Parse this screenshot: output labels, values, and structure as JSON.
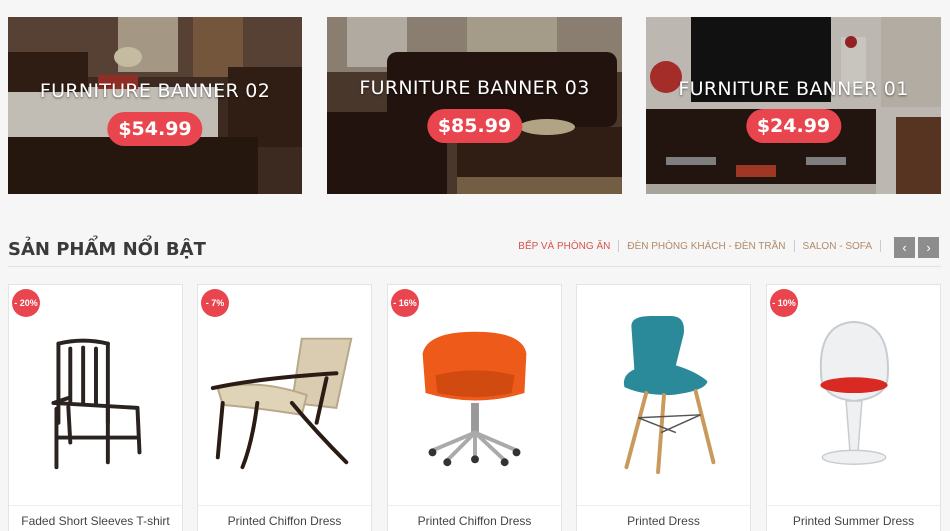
{
  "banners": [
    {
      "title": "FURNITURE BANNER 02",
      "price": "$54.99"
    },
    {
      "title": "FURNITURE BANNER 03",
      "price": "$85.99"
    },
    {
      "title": "FURNITURE BANNER 01",
      "price": "$24.99"
    }
  ],
  "section": {
    "title": "SẢN PHẨM NỔI BẬT",
    "tabs": [
      {
        "label": "BẾP VÀ PHÒNG ĂN",
        "active": true
      },
      {
        "label": "ĐÈN PHÒNG KHÁCH - ĐÈN TRẦN",
        "active": false
      },
      {
        "label": "SALON - SOFA",
        "active": false
      }
    ],
    "prev_icon": "chevron-left-icon",
    "next_icon": "chevron-right-icon"
  },
  "products": [
    {
      "name": "Faded Short Sleeves T-shirt",
      "discount": "- 20%"
    },
    {
      "name": "Printed Chiffon Dress",
      "discount": "- 7%"
    },
    {
      "name": "Printed Chiffon Dress",
      "discount": "- 16%"
    },
    {
      "name": "Printed Dress",
      "discount": ""
    },
    {
      "name": "Printed Summer Dress",
      "discount": "- 10%"
    }
  ],
  "colors": {
    "accent": "#e8454f",
    "tab_text": "#b08a6a",
    "nav_button": "#8d8d8d"
  }
}
